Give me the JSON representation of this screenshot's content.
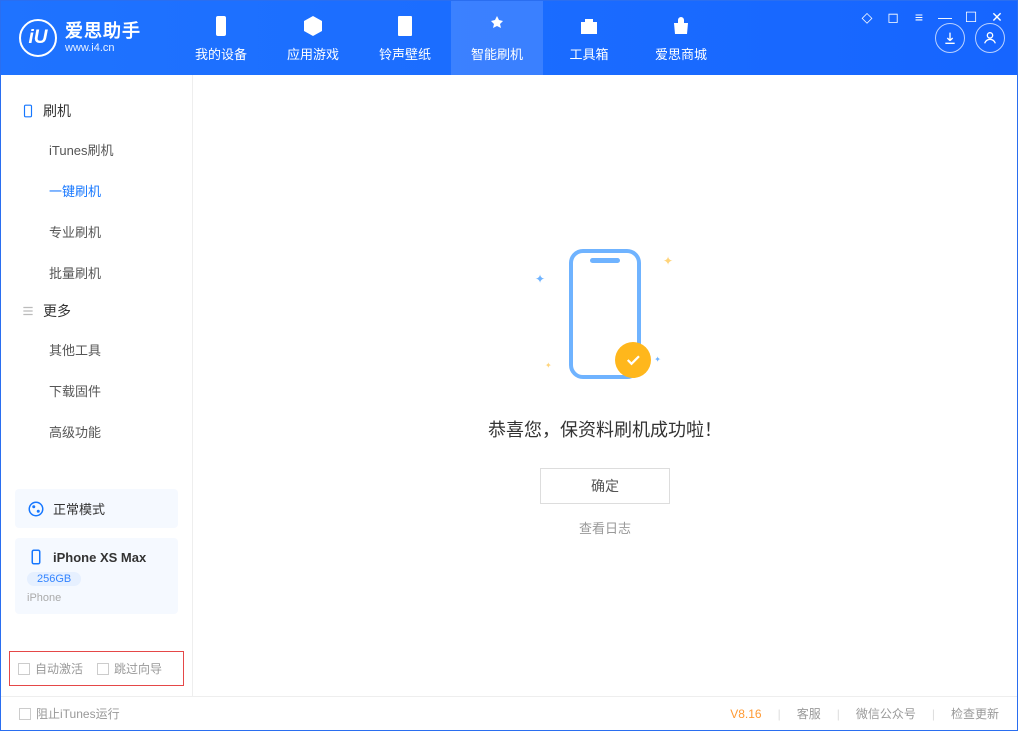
{
  "app": {
    "name": "爱思助手",
    "url": "www.i4.cn"
  },
  "nav": {
    "tabs": [
      "我的设备",
      "应用游戏",
      "铃声壁纸",
      "智能刷机",
      "工具箱",
      "爱思商城"
    ],
    "activeIndex": 3
  },
  "sidebar": {
    "section1": {
      "title": "刷机",
      "items": [
        "iTunes刷机",
        "一键刷机",
        "专业刷机",
        "批量刷机"
      ],
      "activeIndex": 1
    },
    "section2": {
      "title": "更多",
      "items": [
        "其他工具",
        "下载固件",
        "高级功能"
      ]
    },
    "modeCard": {
      "label": "正常模式"
    },
    "deviceCard": {
      "name": "iPhone XS Max",
      "capacity": "256GB",
      "sub": "iPhone"
    },
    "bottom": {
      "opt1": "自动激活",
      "opt2": "跳过向导"
    }
  },
  "main": {
    "successText": "恭喜您，保资料刷机成功啦！",
    "okBtn": "确定",
    "logLink": "查看日志"
  },
  "statusbar": {
    "blockItunes": "阻止iTunes运行",
    "version": "V8.16",
    "links": [
      "客服",
      "微信公众号",
      "检查更新"
    ]
  }
}
